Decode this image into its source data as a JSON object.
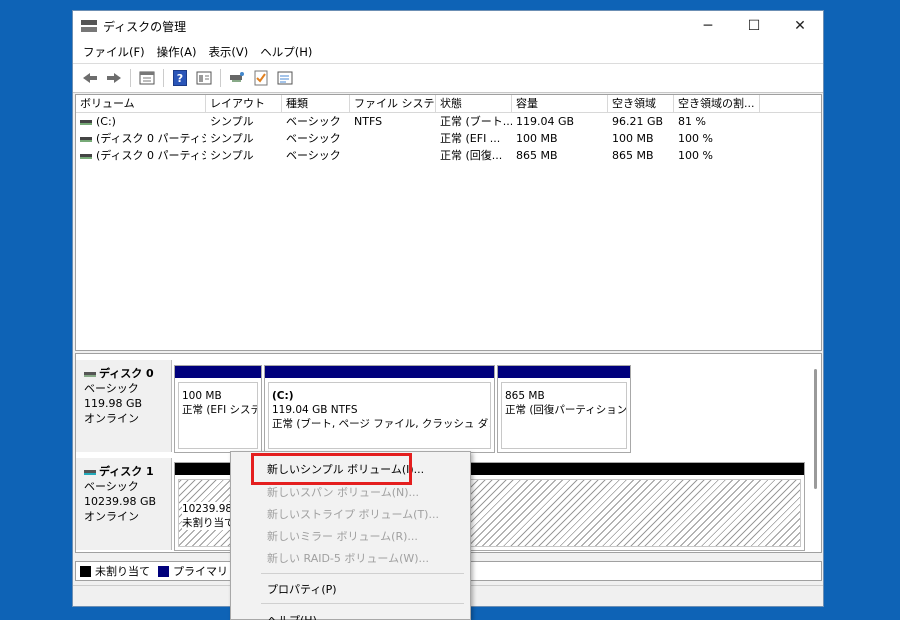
{
  "window": {
    "title": "ディスクの管理"
  },
  "titlebar": {
    "min": "─",
    "max": "☐",
    "close": "✕"
  },
  "menu": [
    "ファイル(F)",
    "操作(A)",
    "表示(V)",
    "ヘルプ(H)"
  ],
  "toolbar": {
    "icons": [
      "back-arrow-icon",
      "forward-arrow-icon",
      "list-view-icon",
      "help-icon",
      "properties-icon",
      "disk-connect-icon",
      "checklist-icon",
      "console-icon"
    ]
  },
  "volumes": {
    "columns": [
      "ボリューム",
      "レイアウト",
      "種類",
      "ファイル システム",
      "状態",
      "容量",
      "空き領域",
      "空き領域の割..."
    ],
    "rows": [
      [
        "(C:)",
        "シンプル",
        "ベーシック",
        "NTFS",
        "正常 (ブート...",
        "119.04 GB",
        "96.21 GB",
        "81 %"
      ],
      [
        "(ディスク 0 パーティシ...",
        "シンプル",
        "ベーシック",
        "",
        "正常 (EFI ...",
        "100 MB",
        "100 MB",
        "100 %"
      ],
      [
        "(ディスク 0 パーティシ...",
        "シンプル",
        "ベーシック",
        "",
        "正常 (回復...",
        "865 MB",
        "865 MB",
        "100 %"
      ]
    ]
  },
  "disks": [
    {
      "name": "ディスク 0",
      "type": "ベーシック",
      "size": "119.98 GB",
      "status": "オンライン",
      "partitions": [
        {
          "title": "",
          "line1": "100 MB",
          "line2": "正常 (EFI システ"
        },
        {
          "title": "(C:)",
          "line1": "119.04 GB NTFS",
          "line2": "正常 (ブート, ページ ファイル, クラッシュ ダンプ, ﾒ"
        },
        {
          "title": "",
          "line1": "865 MB",
          "line2": "正常 (回復パーティション)"
        }
      ]
    },
    {
      "name": "ディスク 1",
      "type": "ベーシック",
      "size": "10239.98 GB",
      "status": "オンライン",
      "partitions": [
        {
          "line1": "10239.98 G",
          "line2": "未割り当て"
        }
      ]
    }
  ],
  "legend": {
    "unallocated": "未割り当て",
    "primary": "プライマリ パー"
  },
  "context_menu": [
    {
      "label": "新しいシンプル ボリューム(I)...",
      "enabled": true
    },
    {
      "label": "新しいスパン ボリューム(N)...",
      "enabled": false
    },
    {
      "label": "新しいストライプ ボリューム(T)...",
      "enabled": false
    },
    {
      "label": "新しいミラー ボリューム(R)...",
      "enabled": false
    },
    {
      "label": "新しい RAID-5 ボリューム(W)...",
      "enabled": false
    },
    {
      "label": "プロパティ(P)",
      "enabled": true
    },
    {
      "label": "ヘルプ(H)",
      "enabled": true
    }
  ],
  "colors": {
    "desktop": "#0e63b6",
    "primary_partition": "#00007c",
    "unallocated": "#000000",
    "highlight": "#e41e1e"
  }
}
